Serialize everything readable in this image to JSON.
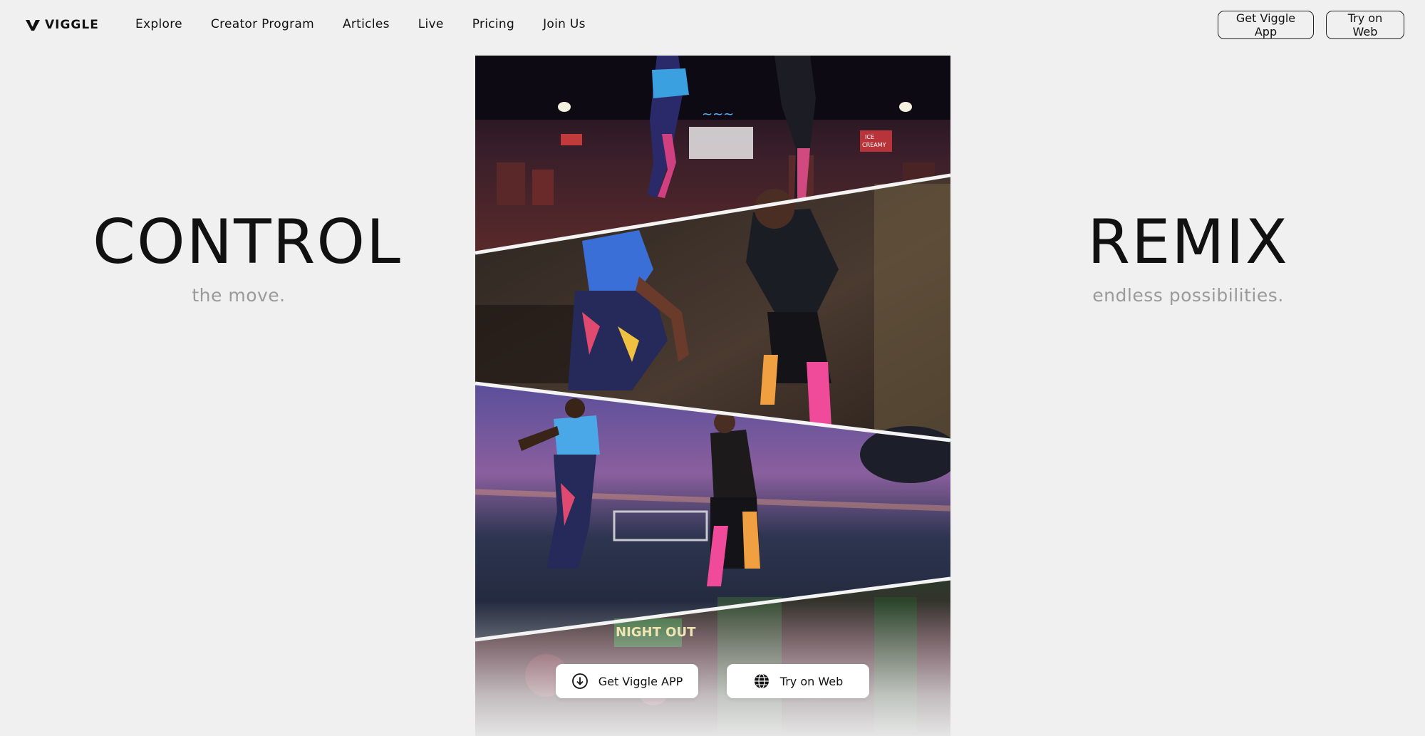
{
  "nav": {
    "logo_text": "VIGGLE",
    "links": [
      {
        "label": "Explore"
      },
      {
        "label": "Creator Program"
      },
      {
        "label": "Articles"
      },
      {
        "label": "Live"
      },
      {
        "label": "Pricing"
      },
      {
        "label": "Join Us"
      }
    ],
    "get_app_label": "Get Viggle App",
    "try_web_label": "Try on Web"
  },
  "hero": {
    "left_title": "CONTROL",
    "left_subtitle": "the move.",
    "right_title": "REMIX",
    "right_subtitle": "endless possibilities."
  },
  "video": {
    "signs": [
      "ICE",
      "CREAMY",
      "NIGHT OUT"
    ]
  },
  "cta": {
    "get_app_label": "Get Viggle APP",
    "try_web_label": "Try on Web"
  },
  "colors": {
    "background": "#f0f0f0",
    "text": "#111111",
    "subtitle": "#9a9a9a",
    "button_bg": "#ffffff"
  },
  "icons": {
    "logo": "viggle-v-logo",
    "download": "download-circle-icon",
    "web": "globe-icon"
  }
}
